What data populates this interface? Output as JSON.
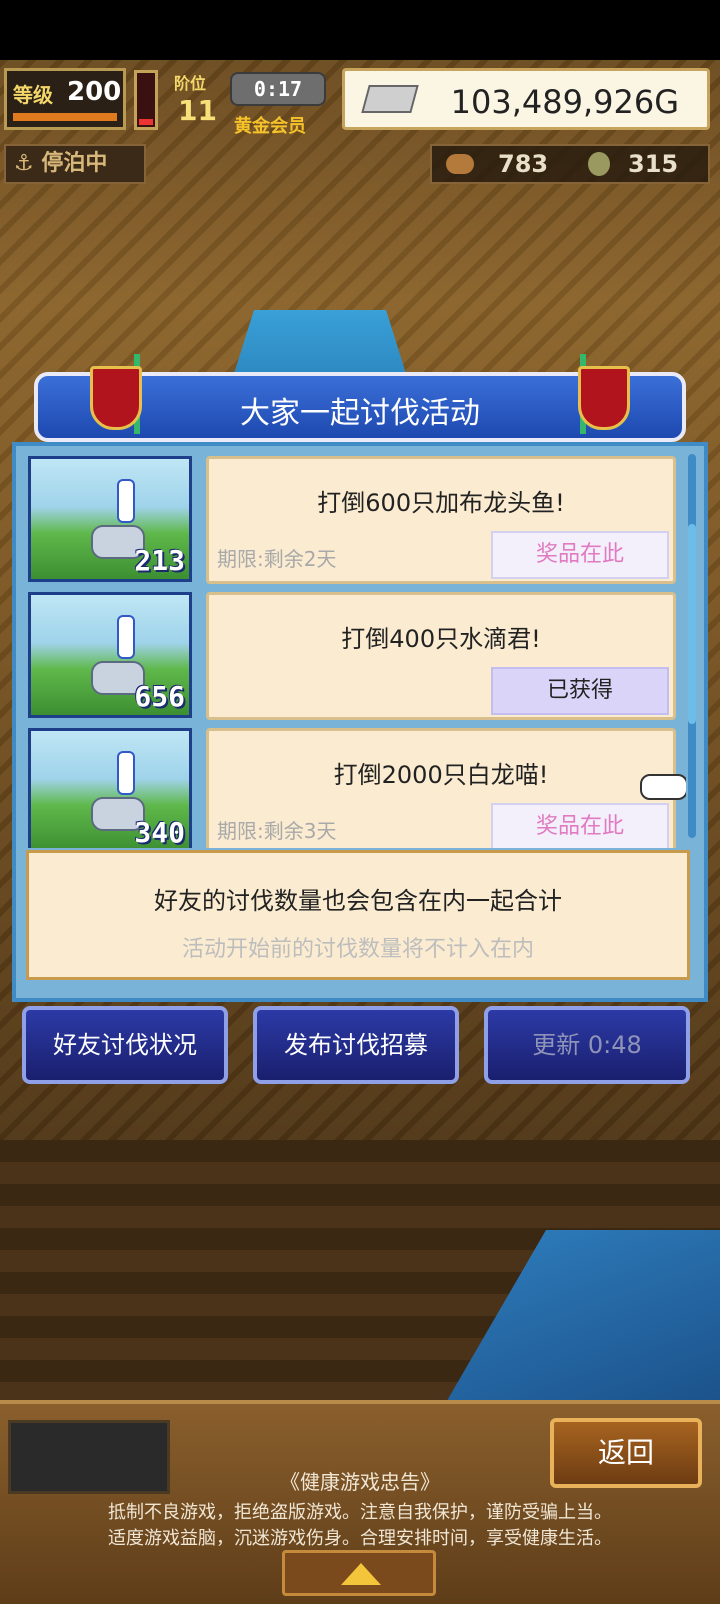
{
  "hud": {
    "level_label": "等级",
    "level_value": "200",
    "rank_label": "阶位",
    "rank_value": "11",
    "timer": "0:17",
    "member_badge": "黄金会员",
    "gold": "103,489,926G",
    "dock_status": "停泊中",
    "food_count": "783",
    "coin_count": "315"
  },
  "dialog": {
    "title": "大家一起讨伐活动",
    "quests": [
      {
        "title": "打倒600只加布龙头鱼!",
        "deadline": "期限:剩余2天",
        "button": "奖品在此",
        "state": "prize",
        "count": "213"
      },
      {
        "title": "打倒400只水滴君!",
        "deadline": "",
        "button": "已获得",
        "state": "done",
        "count": "656"
      },
      {
        "title": "打倒2000只白龙喵!",
        "deadline": "期限:剩余3天",
        "button": "奖品在此",
        "state": "prize",
        "count": "340"
      }
    ],
    "info_main": "好友的讨伐数量也会包含在内一起合计",
    "info_sub": "活动开始前的讨伐数量将不计入在内"
  },
  "actions": {
    "friend_status": "好友讨伐状况",
    "post_recruit": "发布讨伐招募",
    "refresh": "更新 0:48"
  },
  "bottom": {
    "back": "返回",
    "notice_title": "《健康游戏忠告》",
    "notice_line1": "抵制不良游戏，拒绝盗版游戏。注意自我保护，谨防受骗上当。",
    "notice_line2": "适度游戏益脑，沉迷游戏伤身。合理安排时间，享受健康生活。"
  }
}
